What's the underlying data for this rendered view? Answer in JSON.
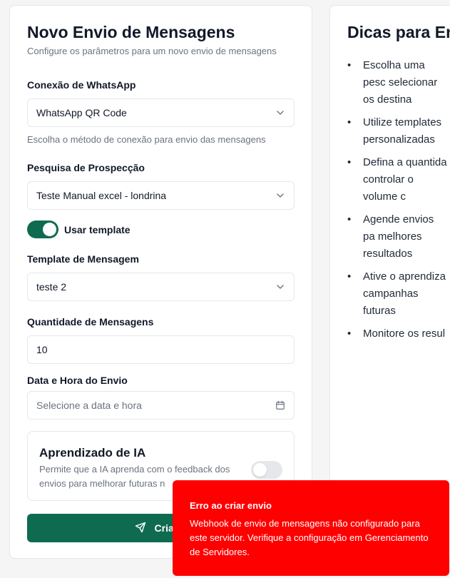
{
  "form": {
    "title": "Novo Envio de Mensagens",
    "subtitle": "Configure os parâmetros para um novo envio de mensagens",
    "connection": {
      "label": "Conexão de WhatsApp",
      "value": "WhatsApp QR Code",
      "help": "Escolha o método de conexão para envio das mensagens"
    },
    "research": {
      "label": "Pesquisa de Prospecção",
      "value": "Teste Manual excel - londrina"
    },
    "use_template": {
      "label": "Usar template",
      "enabled": true
    },
    "template": {
      "label": "Template de Mensagem",
      "value": "teste 2"
    },
    "quantity": {
      "label": "Quantidade de Mensagens",
      "value": "10"
    },
    "datetime": {
      "label": "Data e Hora do Envio",
      "placeholder": "Selecione a data e hora"
    },
    "ai_learning": {
      "title": "Aprendizado de IA",
      "description_line1": "Permite que a IA aprenda com o feedback dos",
      "description_line2": "envios para melhorar futuras n",
      "enabled": false
    },
    "submit_label": "Criar E"
  },
  "tips": {
    "title": "Dicas para Env",
    "items": [
      "Escolha uma pesc selecionar os destina",
      "Utilize templates personalizadas",
      "Defina a quantida controlar o volume c",
      "Agende envios pa melhores resultados",
      "Ative o aprendiza campanhas futuras",
      "Monitore os resul"
    ]
  },
  "toast": {
    "title": "Erro ao criar envio",
    "description": "Webhook de envio de mensagens não configurado para este servidor. Verifique a configuração em Gerenciamento de Servidores."
  },
  "colors": {
    "primary": "#0f6b4f",
    "error": "#ff0000",
    "background": "#f5f5f5"
  }
}
